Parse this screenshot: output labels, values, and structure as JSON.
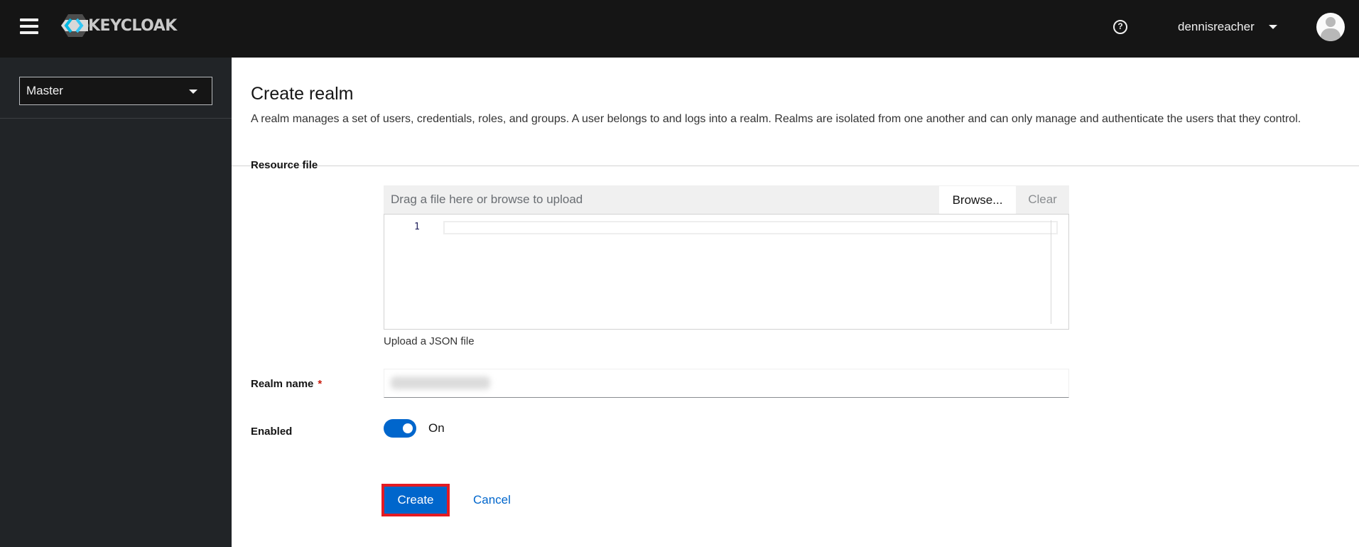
{
  "header": {
    "brand": "KEYCLOAK",
    "username": "dennisreacher",
    "icons": {
      "menu": "hamburger-icon",
      "help": "help-icon",
      "user_caret": "caret-down-icon",
      "avatar": "avatar-icon"
    },
    "help_glyph": "?"
  },
  "sidebar": {
    "realm_selector": {
      "selected": "Master"
    }
  },
  "page": {
    "title": "Create realm",
    "description": "A realm manages a set of users, credentials, roles, and groups. A user belongs to and logs into a realm. Realms are isolated from one another and can only manage and authenticate the users that they control."
  },
  "form": {
    "resource_file": {
      "label": "Resource file",
      "placeholder": "Drag a file here or browse to upload",
      "browse_label": "Browse...",
      "clear_label": "Clear",
      "editor_line_number": "1",
      "helper_text": "Upload a JSON file"
    },
    "realm_name": {
      "label": "Realm name",
      "required_marker": "*",
      "value_obscured": true
    },
    "enabled": {
      "label": "Enabled",
      "state": true,
      "state_label": "On"
    },
    "actions": {
      "create_label": "Create",
      "cancel_label": "Cancel"
    }
  },
  "colors": {
    "masthead": "#151515",
    "sidebar": "#212427",
    "primary": "#0066cc",
    "highlight_border": "#e31b23",
    "required": "#c9190b"
  }
}
